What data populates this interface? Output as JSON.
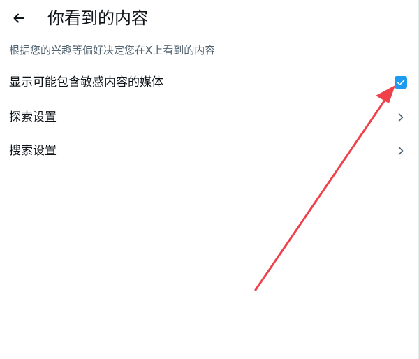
{
  "header": {
    "back_icon": "arrow-left-icon",
    "title": "你看到的内容"
  },
  "description": "根据您的兴趣等偏好决定您在X上看到的内容",
  "settings": {
    "sensitive_media": {
      "label": "显示可能包含敏感内容的媒体",
      "checked": true,
      "check_color": "#1d9bf0"
    },
    "explore": {
      "label": "探索设置",
      "icon": "chevron-right-icon"
    },
    "search": {
      "label": "搜索设置",
      "icon": "chevron-right-icon"
    }
  },
  "annotation": {
    "type": "arrow",
    "color": "#f0414a"
  }
}
